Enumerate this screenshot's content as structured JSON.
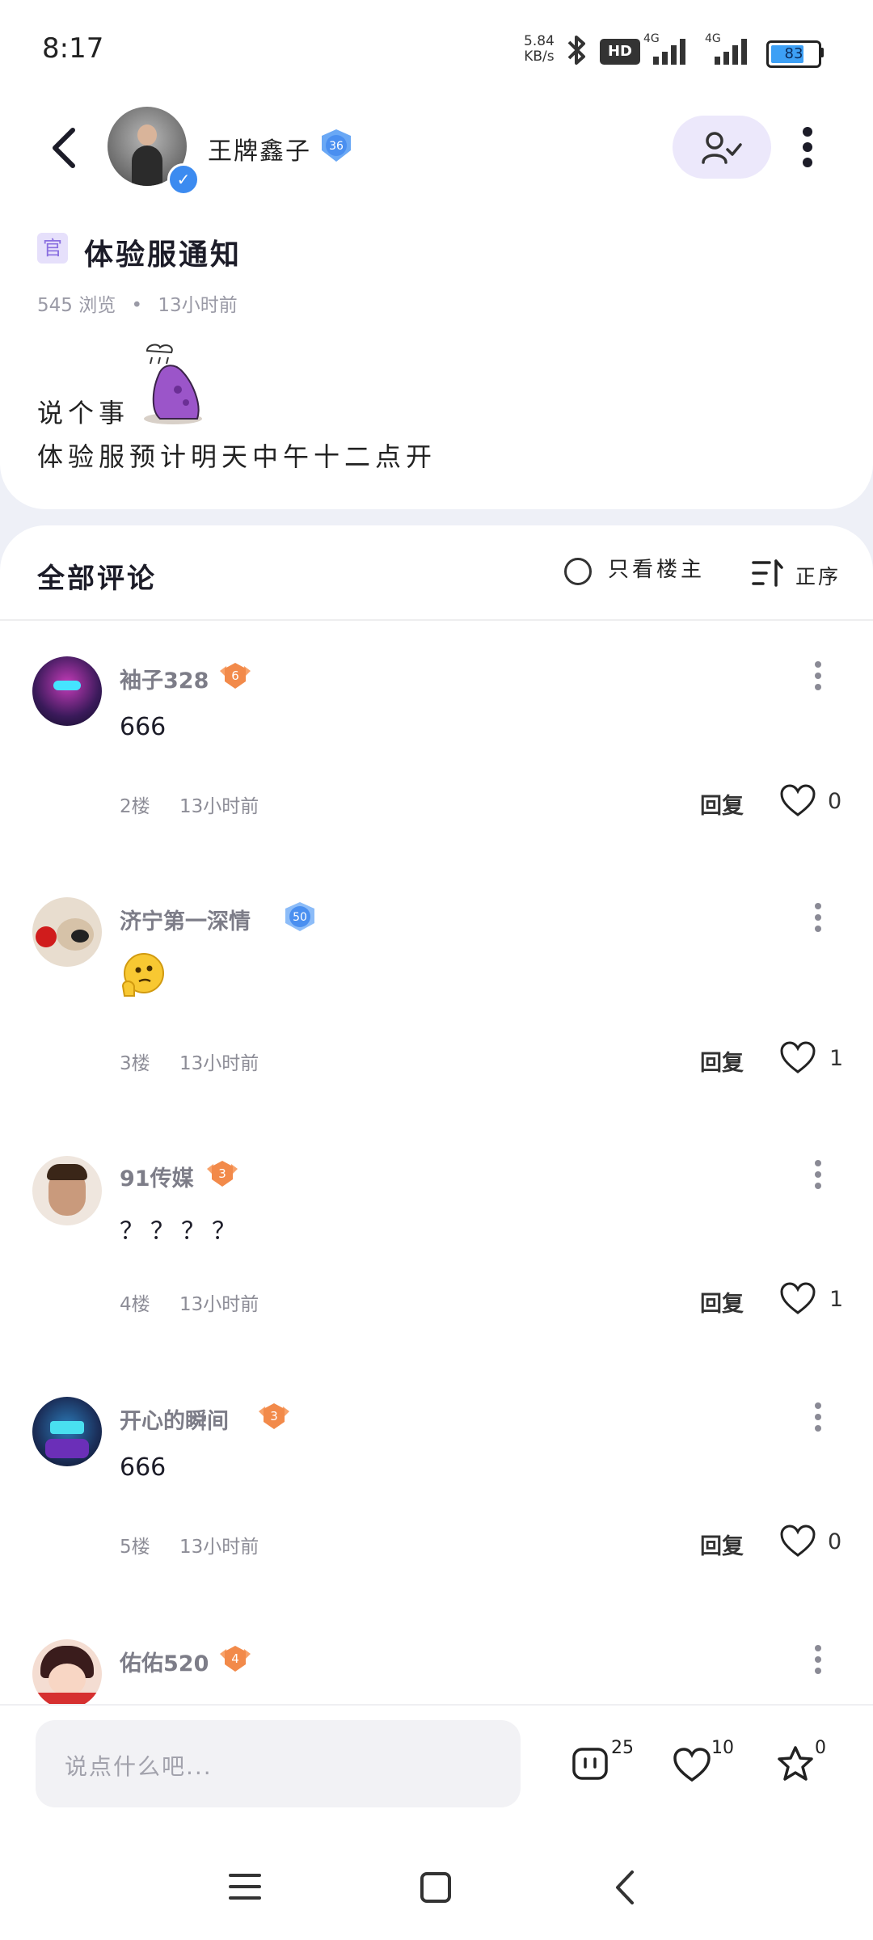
{
  "status_bar": {
    "time": "8:17",
    "speed_value": "5.84",
    "speed_unit": "KB/s",
    "hd_label": "HD",
    "network1": "4G",
    "network2": "4G",
    "battery": "83",
    "battery_level": 0.83
  },
  "header": {
    "username": "王牌鑫子",
    "level": "36",
    "verified_mark": "✓"
  },
  "post": {
    "tag": "官",
    "title": "体验服通知",
    "views": "545 浏览",
    "separator": "•",
    "time": "13小时前",
    "body_line1": "说个事",
    "body_line2": "体验服预计明天中午十二点开"
  },
  "comments_header": {
    "title": "全部评论",
    "only_op_label": "只看楼主",
    "sort_label": "正序"
  },
  "comments": [
    {
      "name": "袖子328",
      "level": "6",
      "text": "666",
      "floor": "2楼",
      "time": "13小时前",
      "reply_label": "回复",
      "likes": "0"
    },
    {
      "name": "济宁第一深情",
      "level": "50",
      "text": "",
      "floor": "3楼",
      "time": "13小时前",
      "reply_label": "回复",
      "likes": "1"
    },
    {
      "name": "91传媒",
      "level": "3",
      "text": "？？？？",
      "floor": "4楼",
      "time": "13小时前",
      "reply_label": "回复",
      "likes": "1"
    },
    {
      "name": "开心的瞬间",
      "level": "3",
      "text": "666",
      "floor": "5楼",
      "time": "13小时前",
      "reply_label": "回复",
      "likes": "0"
    },
    {
      "name": "佑佑520",
      "level": "4",
      "text": "",
      "floor": "",
      "time": "",
      "reply_label": "",
      "likes": ""
    }
  ],
  "bottom_bar": {
    "input_placeholder": "说点什么吧...",
    "comment_count": "25",
    "like_count": "10",
    "fav_count": "0"
  },
  "colors": {
    "accent_purple": "#8a6fe0",
    "follow_bg": "#ece8fb",
    "badge_orange": "#f28a4a",
    "badge_blue": "#4a8ff0",
    "battery_blue": "#3da0f5"
  },
  "icons": [
    "back-icon",
    "verified-icon",
    "follow-user-icon",
    "more-vert-icon",
    "sort-icon",
    "heart-icon",
    "comment-icon",
    "star-icon",
    "menu-nav-icon",
    "home-nav-icon",
    "back-nav-icon",
    "bluetooth-icon",
    "signal-icon",
    "battery-icon"
  ]
}
